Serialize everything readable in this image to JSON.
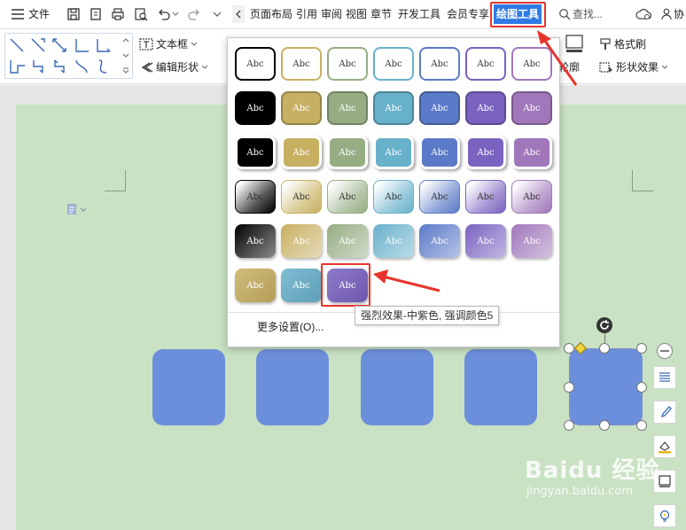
{
  "menubar": {
    "file_label": "文件",
    "tabs": [
      "页面布局",
      "引用",
      "审阅",
      "视图",
      "章节",
      "开发工具",
      "会员专享",
      "绘图工具"
    ],
    "active_tab": "绘图工具",
    "search_label": "查找...",
    "extra_label": "协"
  },
  "ribbon": {
    "textbox_label": "文本框",
    "edit_shape_label": "编辑形状",
    "outline_label": "轮廓",
    "format_painter_label": "格式刷",
    "shape_effect_label": "形状效果"
  },
  "dropdown": {
    "cell_text": "Abc",
    "more_settings": "更多设置(O)...",
    "tooltip": "强烈效果-中紫色, 强调颜色5"
  },
  "colors": {
    "accent": "#2f7be5",
    "highlight_red": "#e8342c",
    "shape_fill": "#6c8fdb",
    "page_bg": "#c9e2c3"
  },
  "watermark": {
    "brand": "Baidu 经验",
    "url": "jingyan.baidu.com"
  }
}
